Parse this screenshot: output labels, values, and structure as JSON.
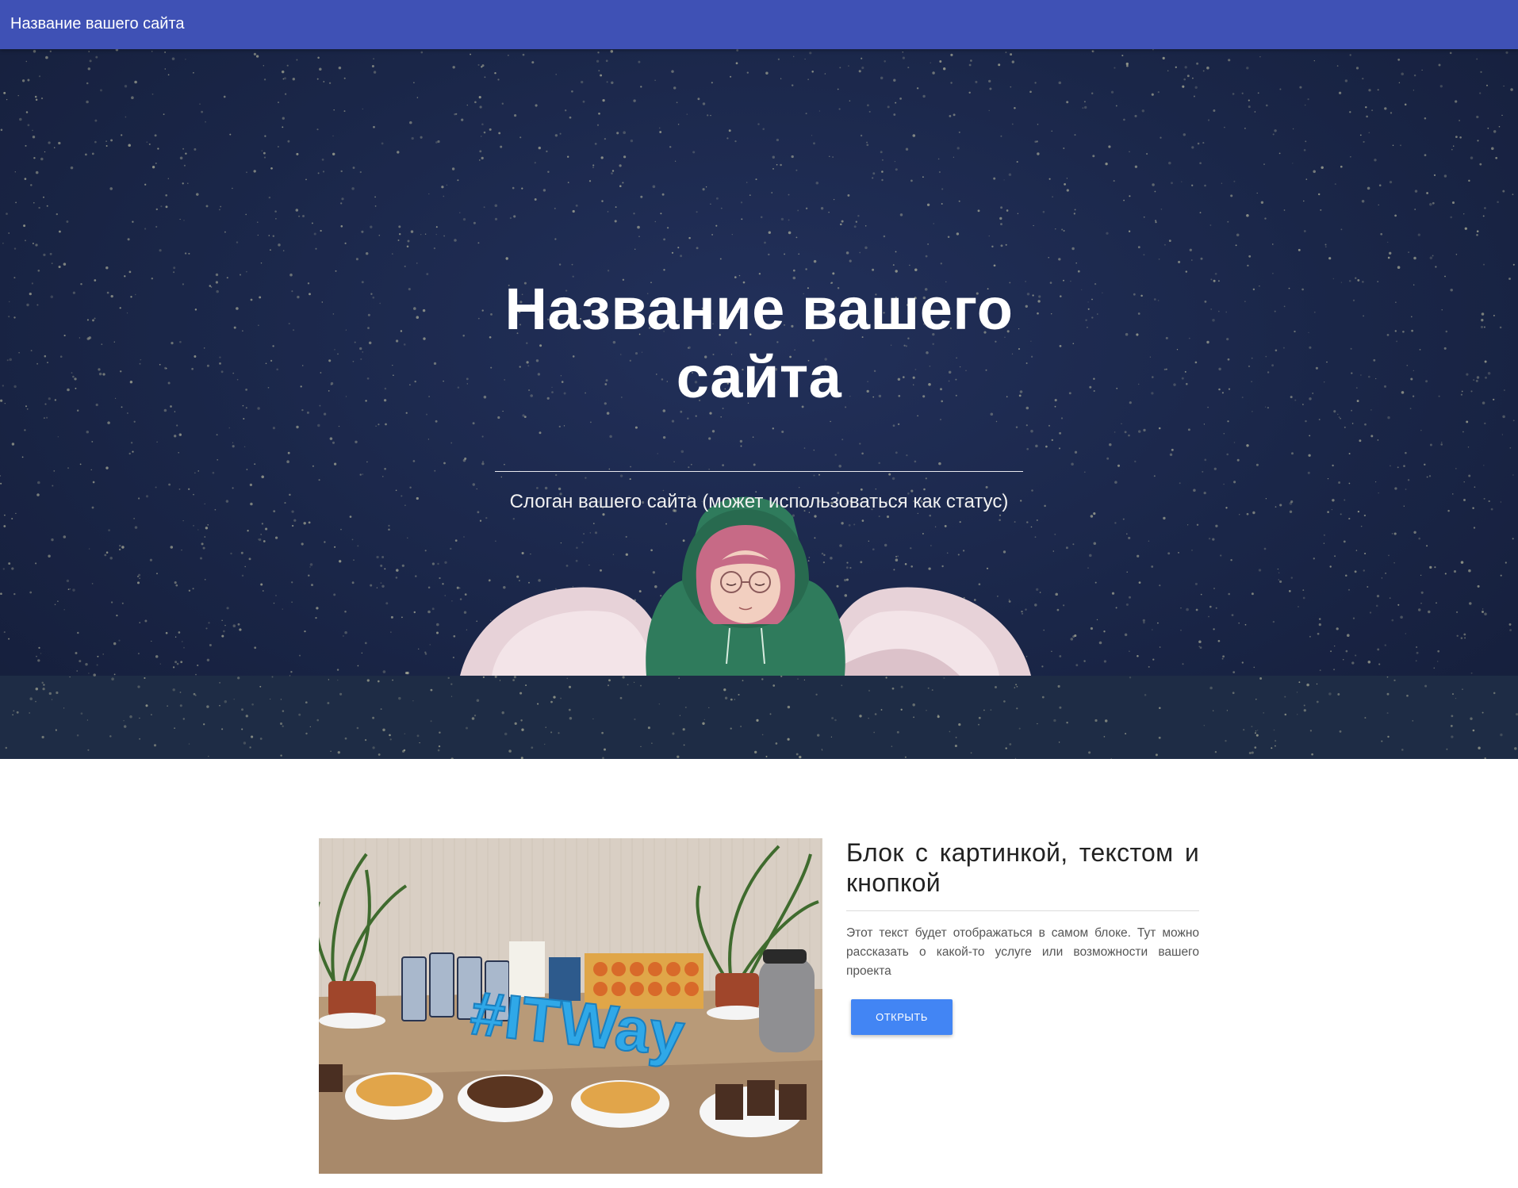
{
  "navbar": {
    "title": "Название вашего сайта"
  },
  "hero": {
    "title": "Название вашего сайта",
    "slogan": "Слоган вашего сайта (может использоваться как статус)"
  },
  "card": {
    "image_text": "#ITWay",
    "title": "Блок с картинкой, текстом и кнопкой",
    "text": "Этот текст будет отображаться в самом блоке. Тут можно рассказать о какой-то услуге или возможности вашего проекта",
    "button_label": "ОТКРЫТЬ"
  },
  "colors": {
    "navbar": "#3f51b5",
    "hero_background": "#1a2648",
    "button": "#4285f4"
  }
}
